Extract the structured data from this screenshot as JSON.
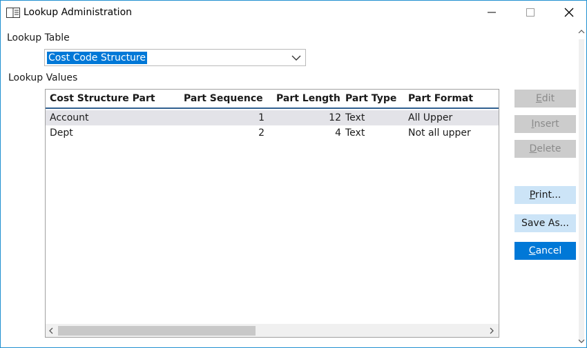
{
  "window": {
    "title": "Lookup Administration",
    "icons": {
      "app": "window-list-icon",
      "minimize": "minimize-icon",
      "maximize": "maximize-icon",
      "close": "close-icon"
    }
  },
  "lookup_table": {
    "label": "Lookup Table",
    "selected_value": "Cost Code Structure",
    "dropdown_icon": "chevron-down-icon"
  },
  "lookup_values": {
    "label": "Lookup Values",
    "columns": [
      "Cost Structure Part",
      "Part Sequence",
      "Part Length",
      "Part Type",
      "Part Format"
    ],
    "rows": [
      {
        "part": "Account",
        "sequence": "1",
        "length": "12",
        "type": "Text",
        "format": "All Upper"
      },
      {
        "part": "Dept",
        "sequence": "2",
        "length": "4",
        "type": "Text",
        "format": "Not all upper"
      }
    ]
  },
  "buttons": {
    "edit": "Edit",
    "insert": "Insert",
    "delete": "Delete",
    "print": "Print...",
    "save_as": "Save As...",
    "cancel": "Cancel"
  },
  "colors": {
    "accent": "#0078d7",
    "selected_row": "#e3e3e8",
    "disabled_button": "#cccccc",
    "secondary_button": "#cce4f7",
    "window_border": "#1f8fd0"
  }
}
